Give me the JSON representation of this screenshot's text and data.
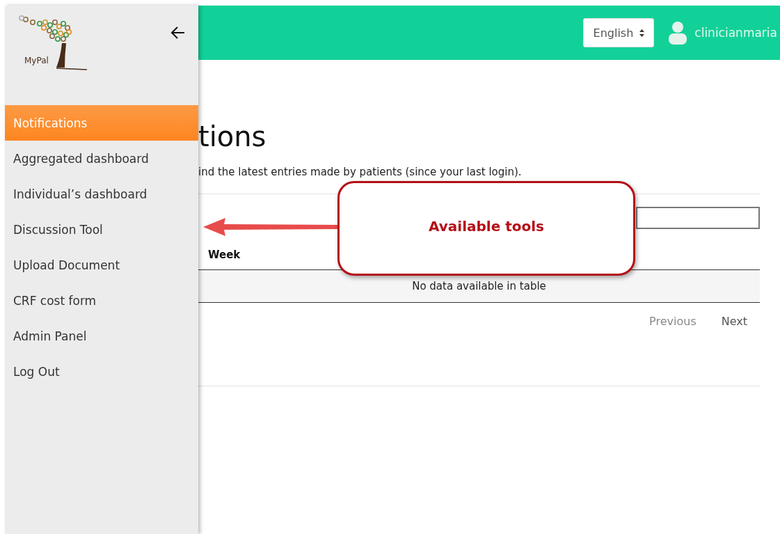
{
  "sidebar": {
    "logo_text": "MyPal",
    "items": [
      {
        "label": "Notifications",
        "selected": true
      },
      {
        "label": "Aggregated dashboard",
        "selected": false
      },
      {
        "label": "Individual’s dashboard",
        "selected": false
      },
      {
        "label": "Discussion Tool",
        "selected": false
      },
      {
        "label": "Upload Document",
        "selected": false
      },
      {
        "label": "CRF cost form",
        "selected": false
      },
      {
        "label": "Admin Panel",
        "selected": false
      },
      {
        "label": "Log Out",
        "selected": false
      }
    ]
  },
  "top_bar": {
    "language": "English",
    "username": "clinicianmaria"
  },
  "page": {
    "title": "tions",
    "description": "ind the latest entries made by patients (since your last login).",
    "table": {
      "columns": [
        "Week"
      ],
      "empty_message": "No data available in table"
    },
    "pagination": [
      "Previous",
      "Next"
    ]
  },
  "callout": {
    "text": "Available tools"
  }
}
